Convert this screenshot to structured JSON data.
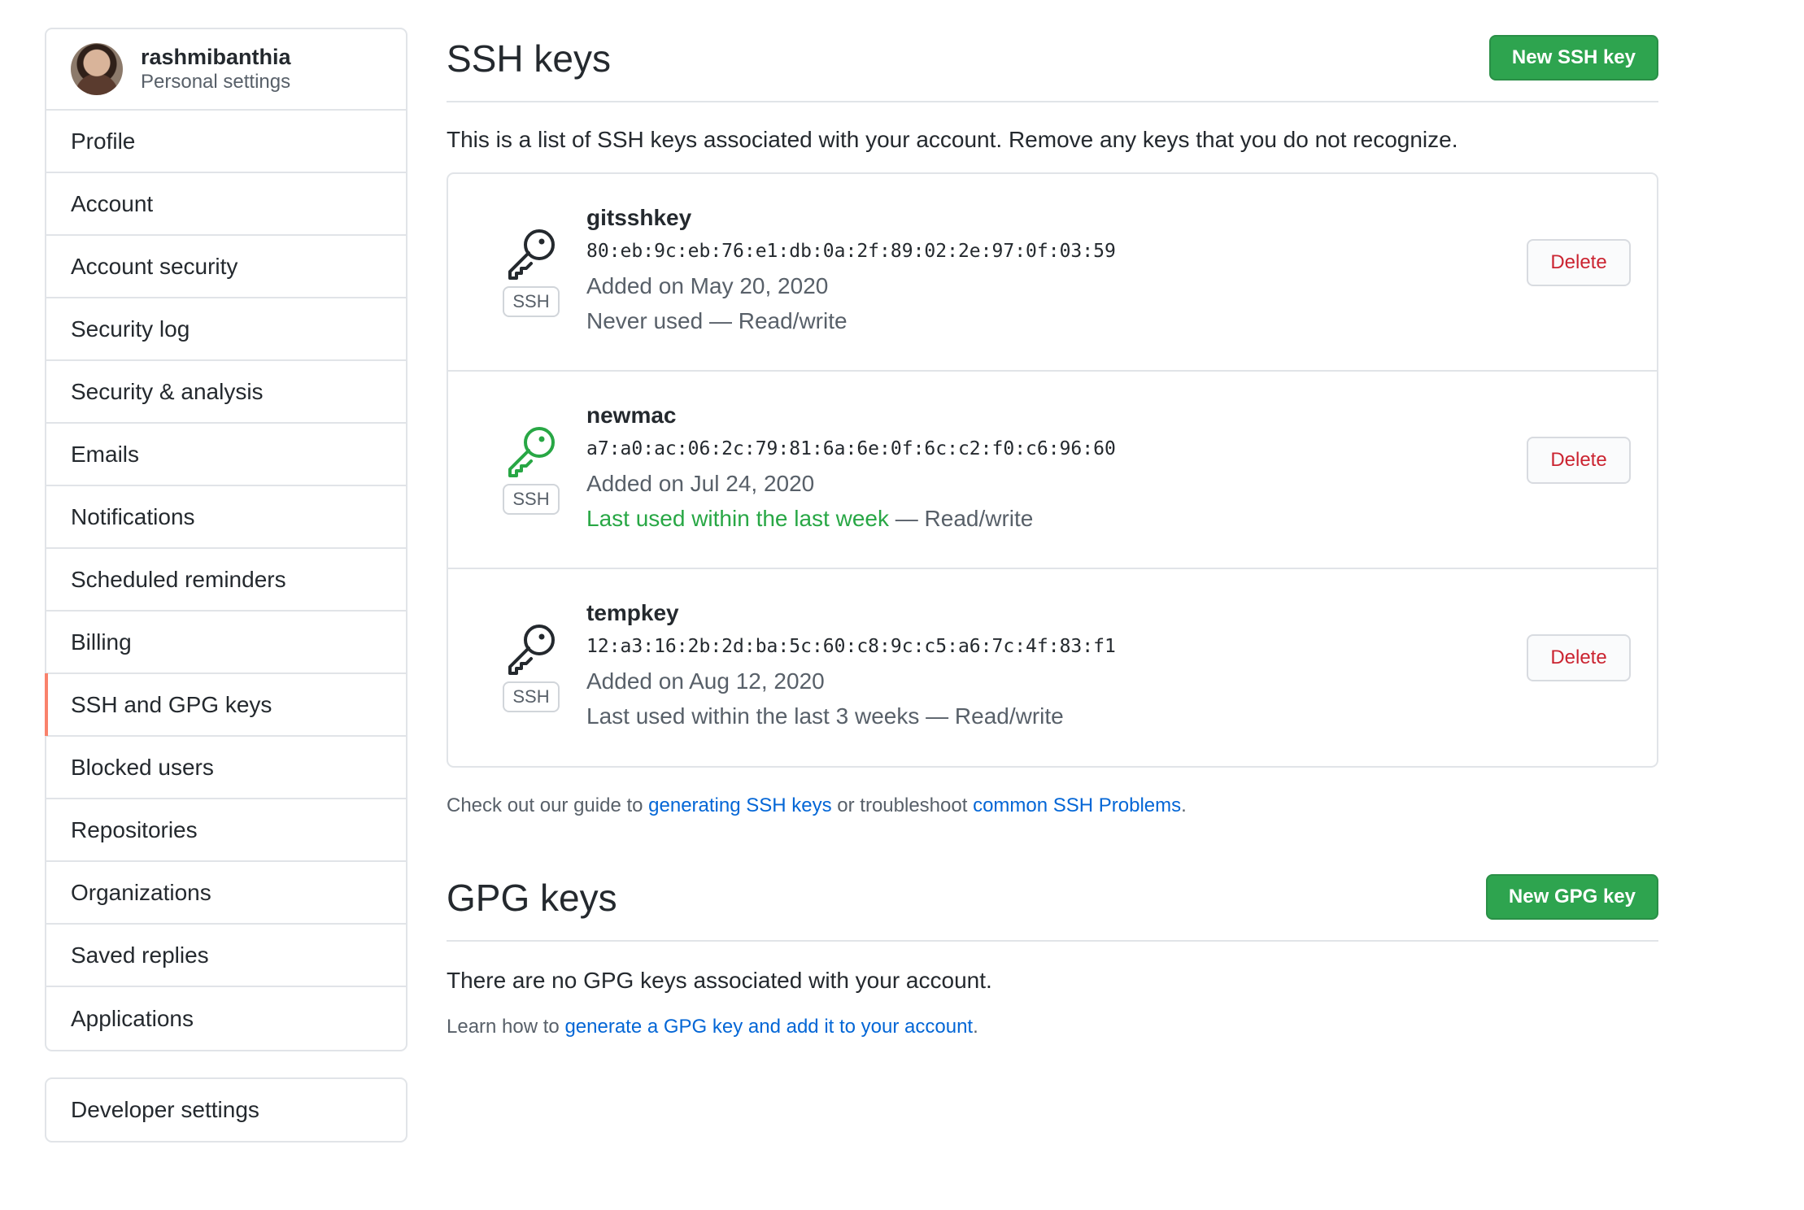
{
  "user": {
    "name": "rashmibanthia",
    "subtitle": "Personal settings"
  },
  "sidebar": {
    "items": [
      {
        "label": "Profile"
      },
      {
        "label": "Account"
      },
      {
        "label": "Account security"
      },
      {
        "label": "Security log"
      },
      {
        "label": "Security & analysis"
      },
      {
        "label": "Emails"
      },
      {
        "label": "Notifications"
      },
      {
        "label": "Scheduled reminders"
      },
      {
        "label": "Billing"
      },
      {
        "label": "SSH and GPG keys",
        "selected": true
      },
      {
        "label": "Blocked users"
      },
      {
        "label": "Repositories"
      },
      {
        "label": "Organizations"
      },
      {
        "label": "Saved replies"
      },
      {
        "label": "Applications"
      }
    ],
    "developer_settings": "Developer settings",
    "selected_accent": "#f9826c"
  },
  "ssh": {
    "title": "SSH keys",
    "new_button": "New SSH key",
    "intro": "This is a list of SSH keys associated with your account. Remove any keys that you do not recognize.",
    "badge": "SSH",
    "delete_label": "Delete",
    "keys": [
      {
        "title": "gitsshkey",
        "fingerprint": "80:eb:9c:eb:76:e1:db:0a:2f:89:02:2e:97:0f:03:59",
        "added": "Added on May 20, 2020",
        "usage": "Never used",
        "access": " — Read/write",
        "icon": "key-icon-gray"
      },
      {
        "title": "newmac",
        "fingerprint": "a7:a0:ac:06:2c:79:81:6a:6e:0f:6c:c2:f0:c6:96:60",
        "added": "Added on Jul 24, 2020",
        "usage": "Last used within the last week",
        "access": " — Read/write",
        "icon": "key-icon-green"
      },
      {
        "title": "tempkey",
        "fingerprint": "12:a3:16:2b:2d:ba:5c:60:c8:9c:c5:a6:7c:4f:83:f1",
        "added": "Added on Aug 12, 2020",
        "usage": "Last used within the last 3 weeks",
        "access": " — Read/write",
        "icon": "key-icon-gray"
      }
    ],
    "guide": {
      "prefix": "Check out our guide to ",
      "link1": "generating SSH keys",
      "middle": " or troubleshoot ",
      "link2": "common SSH Problems",
      "suffix": "."
    }
  },
  "gpg": {
    "title": "GPG keys",
    "new_button": "New GPG key",
    "empty": "There are no GPG keys associated with your account.",
    "learn": {
      "prefix": "Learn how to ",
      "link": "generate a GPG key and add it to your account",
      "suffix": "."
    }
  },
  "colors": {
    "primary": "#2ea44f",
    "danger": "#cb2431",
    "link": "#0366d6",
    "recent_use": "#28a745"
  }
}
